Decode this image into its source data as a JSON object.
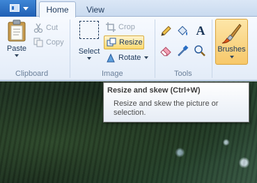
{
  "tabs": [
    {
      "label": "Home"
    },
    {
      "label": "View"
    }
  ],
  "ribbon": {
    "clipboard": {
      "group_label": "Clipboard",
      "paste_label": "Paste",
      "cut_label": "Cut",
      "copy_label": "Copy"
    },
    "image": {
      "group_label": "Image",
      "select_label": "Select",
      "crop_label": "Crop",
      "resize_label": "Resize",
      "rotate_label": "Rotate"
    },
    "tools": {
      "group_label": "Tools",
      "text_glyph": "A"
    },
    "brushes": {
      "label": "Brushes"
    }
  },
  "tooltip": {
    "title": "Resize and skew (Ctrl+W)",
    "body": "Resize and skew the picture or selection."
  },
  "colors": {
    "accent_blue": "#1f5fb4",
    "active_orange": "#f7c86a",
    "ribbon_bg": "#eef3fa"
  }
}
